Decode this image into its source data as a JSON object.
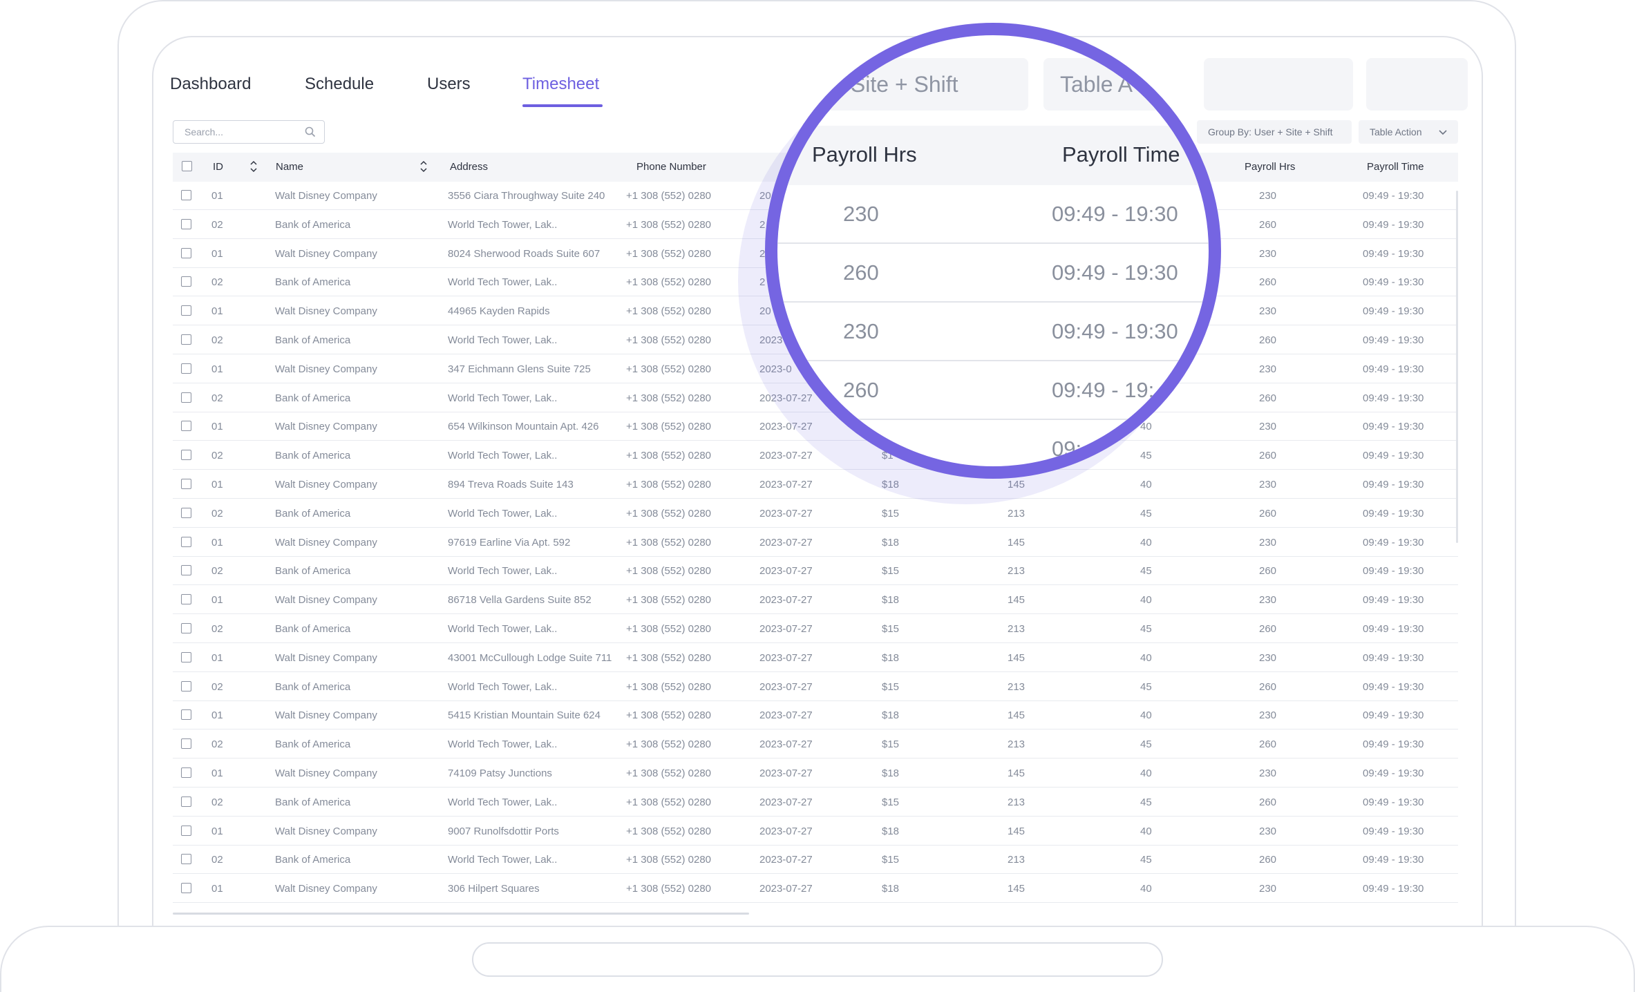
{
  "nav": {
    "tabs": [
      {
        "label": "Dashboard"
      },
      {
        "label": "Schedule"
      },
      {
        "label": "Users"
      },
      {
        "label": "Timesheet"
      }
    ],
    "active_tab": "Timesheet"
  },
  "toolbar": {
    "search_placeholder": "Search...",
    "group_by_label": "Group By: User + Site + Shift",
    "table_action_label": "Table Action"
  },
  "table": {
    "headers": {
      "id": "ID",
      "name": "Name",
      "address": "Address",
      "phone": "Phone Number",
      "payroll_hrs": "Payroll Hrs",
      "payroll_time": "Payroll Time"
    },
    "rows": [
      {
        "id": "01",
        "name": "Walt Disney Company",
        "address": "3556 Ciara Throughway Suite 240",
        "phone": "+1 308 (552) 0280",
        "date": "20",
        "rate": "",
        "c1": "",
        "c2": "",
        "c3": "",
        "hrs": "230",
        "time": "09:49 - 19:30"
      },
      {
        "id": "02",
        "name": "Bank of America",
        "address": "World Tech Tower, Lak..",
        "phone": "+1 308 (552) 0280",
        "date": "2",
        "rate": "",
        "c1": "",
        "c2": "",
        "c3": "",
        "hrs": "260",
        "time": "09:49 - 19:30"
      },
      {
        "id": "01",
        "name": "Walt Disney Company",
        "address": "8024 Sherwood Roads Suite 607",
        "phone": "+1 308 (552) 0280",
        "date": "20",
        "rate": "",
        "c1": "",
        "c2": "",
        "c3": "",
        "hrs": "230",
        "time": "09:49 - 19:30"
      },
      {
        "id": "02",
        "name": "Bank of America",
        "address": "World Tech Tower, Lak..",
        "phone": "+1 308 (552) 0280",
        "date": "2",
        "rate": "",
        "c1": "",
        "c2": "",
        "c3": "",
        "hrs": "260",
        "time": "09:49 - 19:30"
      },
      {
        "id": "01",
        "name": "Walt Disney Company",
        "address": "44965 Kayden Rapids",
        "phone": "+1 308 (552) 0280",
        "date": "20",
        "rate": "",
        "c1": "",
        "c2": "",
        "c3": "",
        "hrs": "230",
        "time": "09:49 - 19:30"
      },
      {
        "id": "02",
        "name": "Bank of America",
        "address": "World Tech Tower, Lak..",
        "phone": "+1 308 (552) 0280",
        "date": "2023",
        "rate": "",
        "c1": "",
        "c2": "",
        "c3": "",
        "hrs": "260",
        "time": "09:49 - 19:30"
      },
      {
        "id": "01",
        "name": "Walt Disney Company",
        "address": "347 Eichmann Glens Suite 725",
        "phone": "+1 308 (552) 0280",
        "date": "2023-0",
        "rate": "",
        "c1": "",
        "c2": "",
        "c3": "",
        "hrs": "230",
        "time": "09:49 - 19:30"
      },
      {
        "id": "02",
        "name": "Bank of America",
        "address": "World Tech Tower, Lak..",
        "phone": "+1 308 (552) 0280",
        "date": "2023-07-27",
        "rate": "",
        "c1": "",
        "c2": "",
        "c3": "",
        "hrs": "260",
        "time": "09:49 - 19:30"
      },
      {
        "id": "01",
        "name": "Walt Disney Company",
        "address": "654 Wilkinson Mountain Apt. 426",
        "phone": "+1 308 (552) 0280",
        "date": "2023-07-27",
        "rate": "",
        "c1": "",
        "c2": "",
        "c3": "40",
        "hrs": "230",
        "time": "09:49 - 19:30"
      },
      {
        "id": "02",
        "name": "Bank of America",
        "address": "World Tech Tower, Lak..",
        "phone": "+1 308 (552) 0280",
        "date": "2023-07-27",
        "rate": "$1",
        "c1": "",
        "c2": "",
        "c3": "45",
        "hrs": "260",
        "time": "09:49 - 19:30"
      },
      {
        "id": "01",
        "name": "Walt Disney Company",
        "address": "894 Treva Roads Suite 143",
        "phone": "+1 308 (552) 0280",
        "date": "2023-07-27",
        "rate": "$18",
        "c1": "145",
        "c2": "",
        "c3": "40",
        "hrs": "230",
        "time": "09:49 - 19:30"
      },
      {
        "id": "02",
        "name": "Bank of America",
        "address": "World Tech Tower, Lak..",
        "phone": "+1 308 (552) 0280",
        "date": "2023-07-27",
        "rate": "$15",
        "c1": "213",
        "c2": "",
        "c3": "45",
        "hrs": "260",
        "time": "09:49 - 19:30"
      },
      {
        "id": "01",
        "name": "Walt Disney Company",
        "address": "97619 Earline Via Apt. 592",
        "phone": "+1 308 (552) 0280",
        "date": "2023-07-27",
        "rate": "$18",
        "c1": "145",
        "c2": "",
        "c3": "40",
        "hrs": "230",
        "time": "09:49 - 19:30"
      },
      {
        "id": "02",
        "name": "Bank of America",
        "address": "World Tech Tower, Lak..",
        "phone": "+1 308 (552) 0280",
        "date": "2023-07-27",
        "rate": "$15",
        "c1": "213",
        "c2": "",
        "c3": "45",
        "hrs": "260",
        "time": "09:49 - 19:30"
      },
      {
        "id": "01",
        "name": "Walt Disney Company",
        "address": "86718 Vella Gardens Suite 852",
        "phone": "+1 308 (552) 0280",
        "date": "2023-07-27",
        "rate": "$18",
        "c1": "145",
        "c2": "",
        "c3": "40",
        "hrs": "230",
        "time": "09:49 - 19:30"
      },
      {
        "id": "02",
        "name": "Bank of America",
        "address": "World Tech Tower, Lak..",
        "phone": "+1 308 (552) 0280",
        "date": "2023-07-27",
        "rate": "$15",
        "c1": "213",
        "c2": "",
        "c3": "45",
        "hrs": "260",
        "time": "09:49 - 19:30"
      },
      {
        "id": "01",
        "name": "Walt Disney Company",
        "address": "43001 McCullough Lodge Suite 711",
        "phone": "+1 308 (552) 0280",
        "date": "2023-07-27",
        "rate": "$18",
        "c1": "145",
        "c2": "",
        "c3": "40",
        "hrs": "230",
        "time": "09:49 - 19:30"
      },
      {
        "id": "02",
        "name": "Bank of America",
        "address": "World Tech Tower, Lak..",
        "phone": "+1 308 (552) 0280",
        "date": "2023-07-27",
        "rate": "$15",
        "c1": "213",
        "c2": "",
        "c3": "45",
        "hrs": "260",
        "time": "09:49 - 19:30"
      },
      {
        "id": "01",
        "name": "Walt Disney Company",
        "address": "5415 Kristian Mountain Suite 624",
        "phone": "+1 308 (552) 0280",
        "date": "2023-07-27",
        "rate": "$18",
        "c1": "145",
        "c2": "",
        "c3": "40",
        "hrs": "230",
        "time": "09:49 - 19:30"
      },
      {
        "id": "02",
        "name": "Bank of America",
        "address": "World Tech Tower, Lak..",
        "phone": "+1 308 (552) 0280",
        "date": "2023-07-27",
        "rate": "$15",
        "c1": "213",
        "c2": "",
        "c3": "45",
        "hrs": "260",
        "time": "09:49 - 19:30"
      },
      {
        "id": "01",
        "name": "Walt Disney Company",
        "address": "74109 Patsy Junctions",
        "phone": "+1 308 (552) 0280",
        "date": "2023-07-27",
        "rate": "$18",
        "c1": "145",
        "c2": "",
        "c3": "40",
        "hrs": "230",
        "time": "09:49 - 19:30"
      },
      {
        "id": "02",
        "name": "Bank of America",
        "address": "World Tech Tower, Lak..",
        "phone": "+1 308 (552) 0280",
        "date": "2023-07-27",
        "rate": "$15",
        "c1": "213",
        "c2": "",
        "c3": "45",
        "hrs": "260",
        "time": "09:49 - 19:30"
      },
      {
        "id": "01",
        "name": "Walt Disney Company",
        "address": "9007 Runolfsdottir Ports",
        "phone": "+1 308 (552) 0280",
        "date": "2023-07-27",
        "rate": "$18",
        "c1": "145",
        "c2": "",
        "c3": "40",
        "hrs": "230",
        "time": "09:49 - 19:30"
      },
      {
        "id": "02",
        "name": "Bank of America",
        "address": "World Tech Tower, Lak..",
        "phone": "+1 308 (552) 0280",
        "date": "2023-07-27",
        "rate": "$15",
        "c1": "213",
        "c2": "",
        "c3": "45",
        "hrs": "260",
        "time": "09:49 - 19:30"
      },
      {
        "id": "01",
        "name": "Walt Disney Company",
        "address": "306 Hilpert Squares",
        "phone": "+1 308 (552) 0280",
        "date": "2023-07-27",
        "rate": "$18",
        "c1": "145",
        "c2": "",
        "c3": "40",
        "hrs": "230",
        "time": "09:49 - 19:30"
      }
    ]
  },
  "magnifier": {
    "group_by_fragment": "ser + Site + Shift",
    "table_action_fragment": "Table A",
    "headers": {
      "payroll_hrs": "Payroll Hrs",
      "payroll_time": "Payroll Time"
    },
    "rows": [
      {
        "hrs": "230",
        "time": "09:49 - 19:30"
      },
      {
        "hrs": "260",
        "time": "09:49 - 19:30"
      },
      {
        "hrs": "230",
        "time": "09:49 - 19:30"
      },
      {
        "hrs": "260",
        "time": "09:49 - 19:"
      },
      {
        "hrs": "",
        "time": "09:"
      }
    ]
  },
  "colors": {
    "accent": "#6d5fe0",
    "magnifier_ring": "#7565e2",
    "header_bg": "#f4f5f8",
    "muted_text": "#848b99"
  }
}
